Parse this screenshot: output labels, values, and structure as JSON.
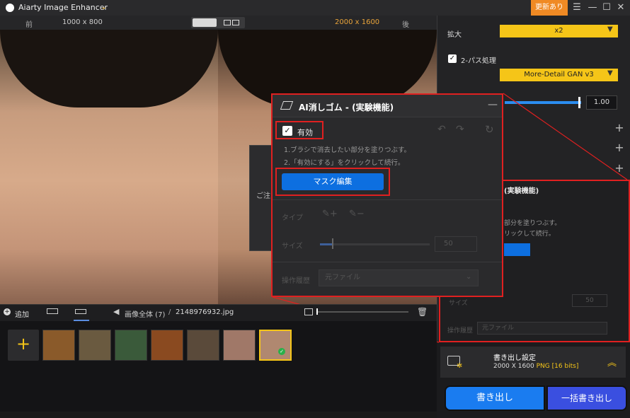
{
  "app": {
    "title": "Aiarty Image Enhancer",
    "update_label": "更新あり"
  },
  "window_controls": {
    "menu": "☰",
    "minimize": "—",
    "maximize": "☐",
    "close": "✕"
  },
  "preview": {
    "before_label": "前",
    "before_res": "1000 x 800",
    "after_res": "2000 x 1600",
    "after_label": "後"
  },
  "ghost_dialog_text": "ご注",
  "settings": {
    "scale_label": "拡大",
    "scale_value": "x2",
    "two_pass_label": "2-パス処理",
    "model_value": "More-Detail GAN v3",
    "strength_value": "1.00",
    "strength_fraction": 1.0,
    "plus_icon": "+"
  },
  "panel_ghost": {
    "title": "(実験機能)",
    "instr1": "部分を塗りつぶす。",
    "instr2": "リックして続行。",
    "size_label": "サイズ",
    "size_value": "50",
    "history_label": "操作履歴",
    "history_value": "元ファイル"
  },
  "dialog": {
    "title": "AI消しゴム - (実験機能)",
    "minimize": "—",
    "enable_label": "有効",
    "enable_checked": true,
    "instr1": "1.ブラシで消去したい部分を塗りつぶす。",
    "instr2": "2.「有効にする」をクリックして続行。",
    "mask_button": "マスク編集",
    "type_label": "タイプ",
    "size_label": "サイズ",
    "size_value": "50",
    "history_label": "操作履歴",
    "history_value": "元ファイル",
    "brush_add_icon": "brush-add-icon",
    "brush_remove_icon": "brush-remove-icon"
  },
  "export": {
    "title": "書き出し設定",
    "res": "2000 X 1600",
    "format": "PNG",
    "bits": "[16 bits]",
    "export_button": "書き出し",
    "batch_button": "一括書き出し"
  },
  "gallery": {
    "add_label": "追加",
    "crumb_all": "画像全体 (7)",
    "crumb_sep": "/",
    "crumb_file": "2148976932.jpg",
    "add_thumb_icon": "+",
    "thumbs": [
      {
        "name": "tiger",
        "color": "#8a5a2a"
      },
      {
        "name": "bird",
        "color": "#6a5a40"
      },
      {
        "name": "forest",
        "color": "#3a5a3a"
      },
      {
        "name": "burger",
        "color": "#8a4a20"
      },
      {
        "name": "dog",
        "color": "#5a4a3a"
      },
      {
        "name": "woman1",
        "color": "#a07868"
      },
      {
        "name": "woman2",
        "color": "#b08870"
      }
    ]
  },
  "colors": {
    "accent": "#f5c518",
    "primary": "#1a7cf0",
    "highlight": "#e02020"
  }
}
